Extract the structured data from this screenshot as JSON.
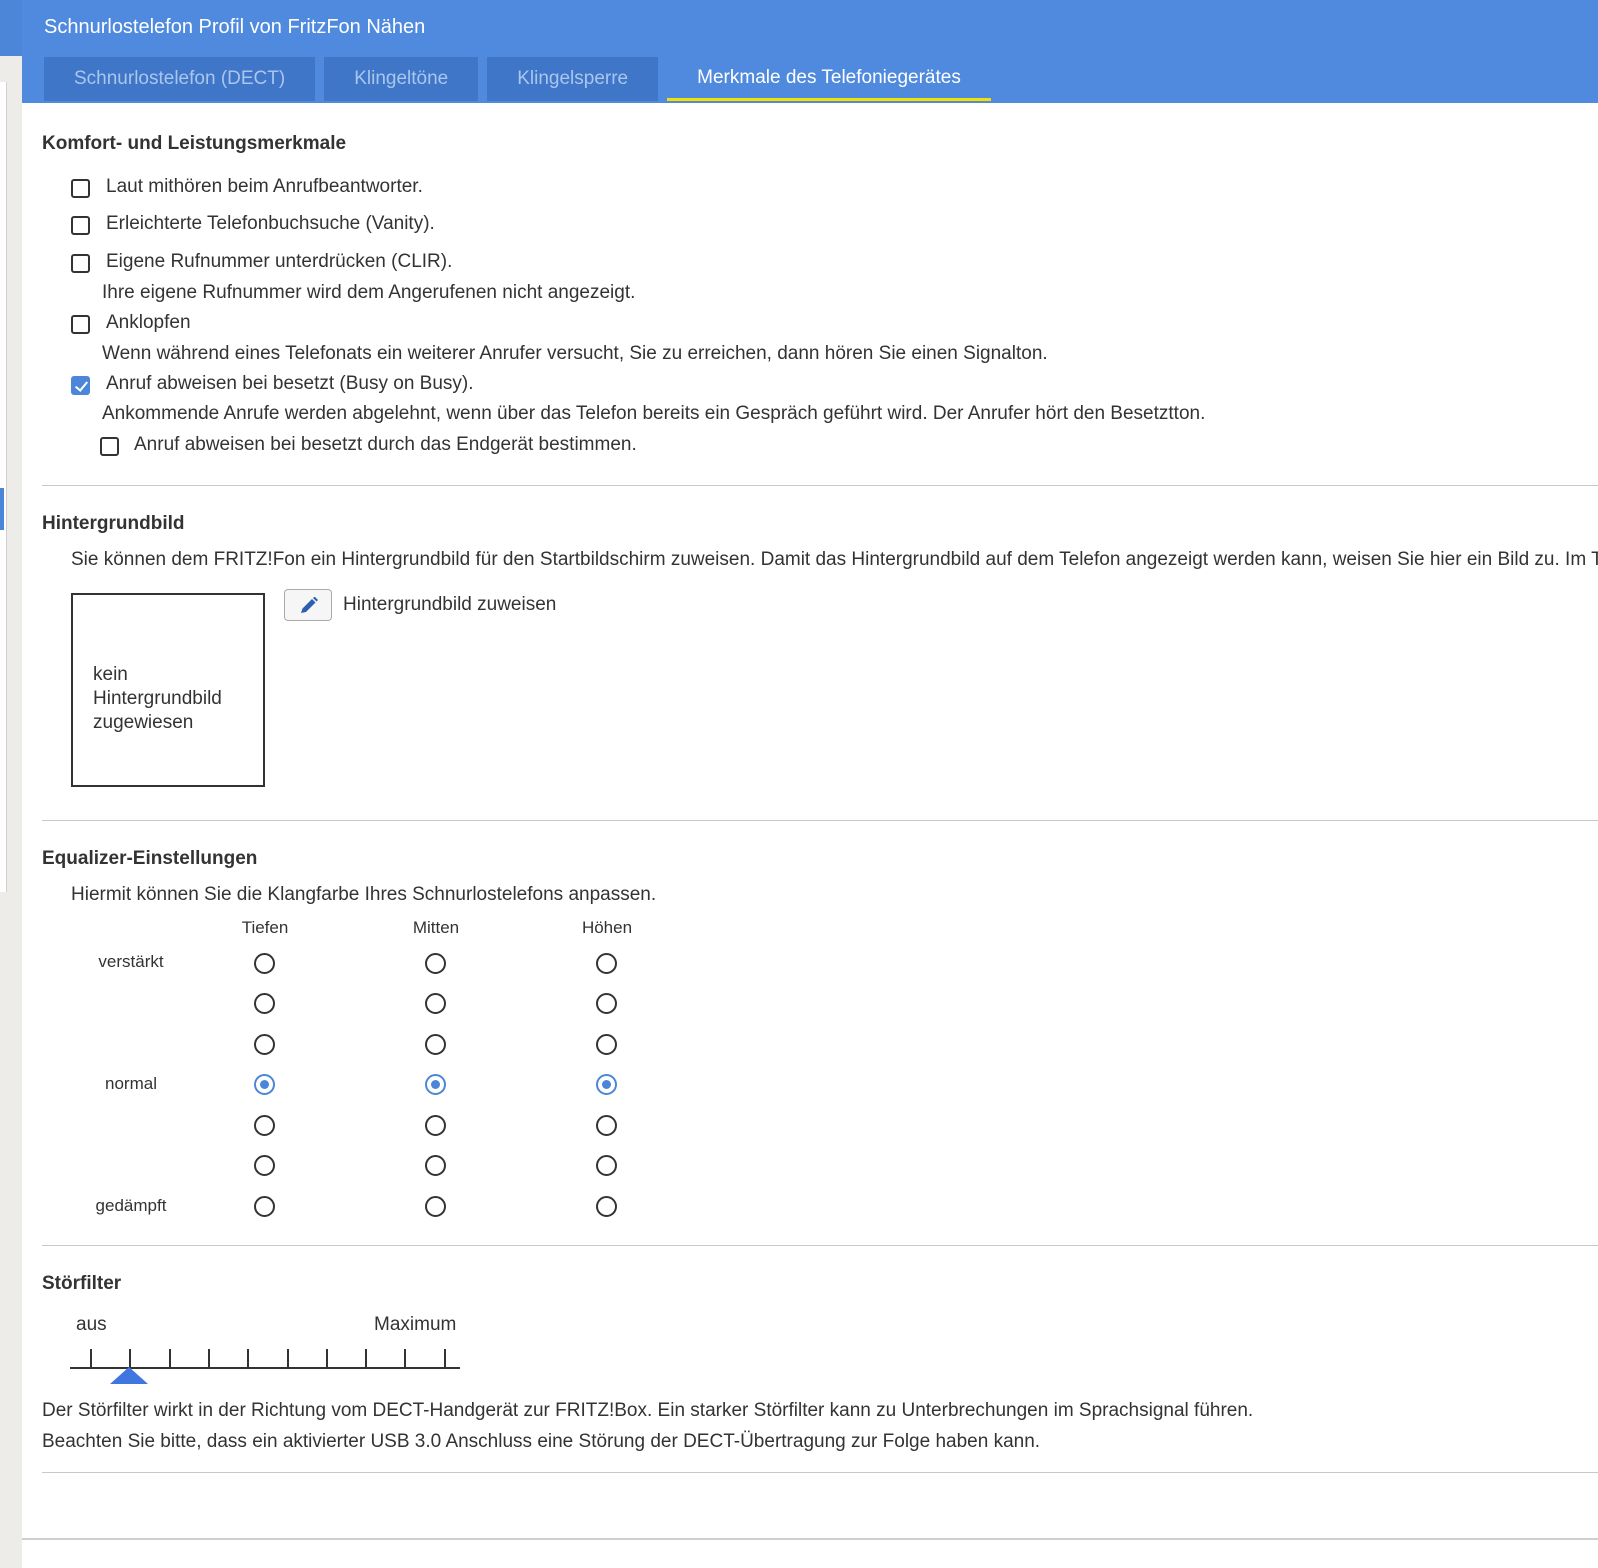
{
  "window": {
    "title": "Schnurlostelefon Profil von FritzFon Nähen"
  },
  "tabs": [
    {
      "label": "Schnurlostelefon (DECT)",
      "active": false
    },
    {
      "label": "Klingeltöne",
      "active": false
    },
    {
      "label": "Klingelsperre",
      "active": false
    },
    {
      "label": "Merkmale des Telefoniegerätes",
      "active": true
    }
  ],
  "komfort": {
    "heading": "Komfort- und Leistungsmerkmale",
    "items": [
      {
        "label": "Laut mithören beim Anrufbeantworter.",
        "checked": false
      },
      {
        "label": "Erleichterte Telefonbuchsuche (Vanity).",
        "checked": false
      },
      {
        "label": "Eigene Rufnummer unterdrücken (CLIR).",
        "checked": false,
        "hint": "Ihre eigene Rufnummer wird dem Angerufenen nicht angezeigt."
      },
      {
        "label": "Anklopfen",
        "checked": false,
        "hint": "Wenn während eines Telefonats ein weiterer Anrufer versucht, Sie zu erreichen, dann hören Sie einen Signalton."
      },
      {
        "label": "Anruf abweisen bei besetzt (Busy on Busy).",
        "checked": true,
        "hint": "Ankommende Anrufe werden abgelehnt, wenn über das Telefon bereits ein Gespräch geführt wird. Der Anrufer hört den Besetztton."
      },
      {
        "label": "Anruf abweisen bei besetzt durch das Endgerät bestimmen.",
        "checked": false
      }
    ]
  },
  "hintergrund": {
    "heading": "Hintergrundbild",
    "description": "Sie können dem FRITZ!Fon ein Hintergrundbild für den Startbildschirm zuweisen. Damit das Hintergrundbild auf dem Telefon angezeigt werden kann, weisen Sie hier ein Bild zu. Im Tele",
    "placeholder": "kein Hintergrundbild zugewiesen",
    "assign_label": "Hintergrundbild zuweisen",
    "edit_icon": "pencil-icon"
  },
  "equalizer": {
    "heading": "Equalizer-Einstellungen",
    "description": "Hiermit können Sie die Klangfarbe Ihres Schnurlostelefons anpassen.",
    "columns": [
      "Tiefen",
      "Mitten",
      "Höhen"
    ],
    "row_labels": {
      "top": "verstärkt",
      "middle": "normal",
      "bottom": "gedämpft"
    },
    "levels": 7,
    "selected_level_index": [
      3,
      3,
      3
    ]
  },
  "stoerfilter": {
    "heading": "Störfilter",
    "min_label": "aus",
    "max_label": "Maximum",
    "ticks": 10,
    "value_index": 1,
    "note1": "Der Störfilter wirkt in der Richtung vom DECT-Handgerät zur FRITZ!Box. Ein starker Störfilter kann zu Unterbrechungen im Sprachsignal führen.",
    "note2": "Beachten Sie bitte, dass ein aktivierter USB 3.0 Anschluss eine Störung der DECT-Übertragung zur Folge haben kann."
  },
  "colors": {
    "accent": "#4b86d9",
    "header": "#4f8ade",
    "tab_indicator": "#f4e000"
  }
}
